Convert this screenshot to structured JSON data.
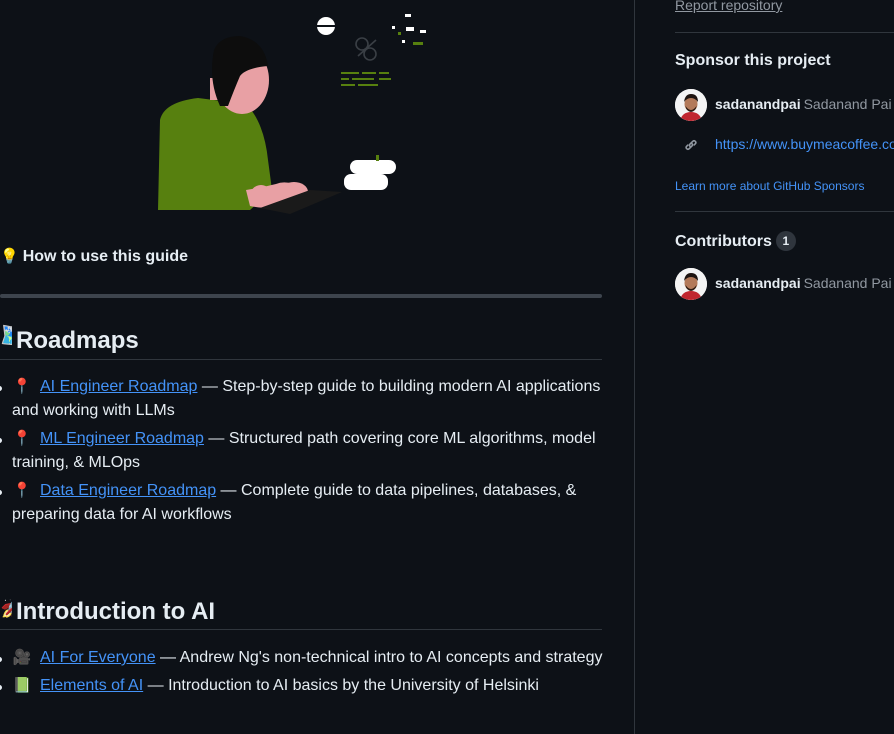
{
  "readme": {
    "how_to": {
      "emoji": "💡",
      "label": "How to use this guide"
    },
    "sections": [
      {
        "emoji": "🗺️",
        "title": "Roadmaps",
        "items": [
          {
            "icon": "📍",
            "link": "AI Engineer Roadmap",
            "desc": " — Step-by-step guide to building modern AI applications and working with LLMs"
          },
          {
            "icon": "📍",
            "link": "ML Engineer Roadmap",
            "desc": " — Structured path covering core ML algorithms, model training, & MLOps"
          },
          {
            "icon": "📍",
            "link": "Data Engineer Roadmap",
            "desc": " — Complete guide to data pipelines, databases, & preparing data for AI workflows"
          }
        ]
      },
      {
        "emoji": "🚀",
        "title": "Introduction to AI",
        "items": [
          {
            "icon": "🎥",
            "link": "AI For Everyone",
            "desc": " — Andrew Ng's non-technical intro to AI concepts and strategy"
          },
          {
            "icon": "📗",
            "link": "Elements of AI",
            "desc": " — Introduction to AI basics by the University of Helsinki"
          }
        ]
      }
    ]
  },
  "sidebar": {
    "report_link": "Report repository",
    "sponsor": {
      "heading": "Sponsor this project",
      "login": "sadanandpai",
      "name": "Sadanand Pai",
      "url": "https://www.buymeacoffee.com/sadanandpai",
      "learn_more": "Learn more about GitHub Sponsors"
    },
    "contributors": {
      "heading": "Contributors",
      "count": "1",
      "people": [
        {
          "login": "sadanandpai",
          "name": "Sadanand Pai"
        }
      ]
    }
  },
  "colors": {
    "background": "#0d1117",
    "link": "#4493f8",
    "muted": "#9198a1",
    "border": "#30363d"
  }
}
